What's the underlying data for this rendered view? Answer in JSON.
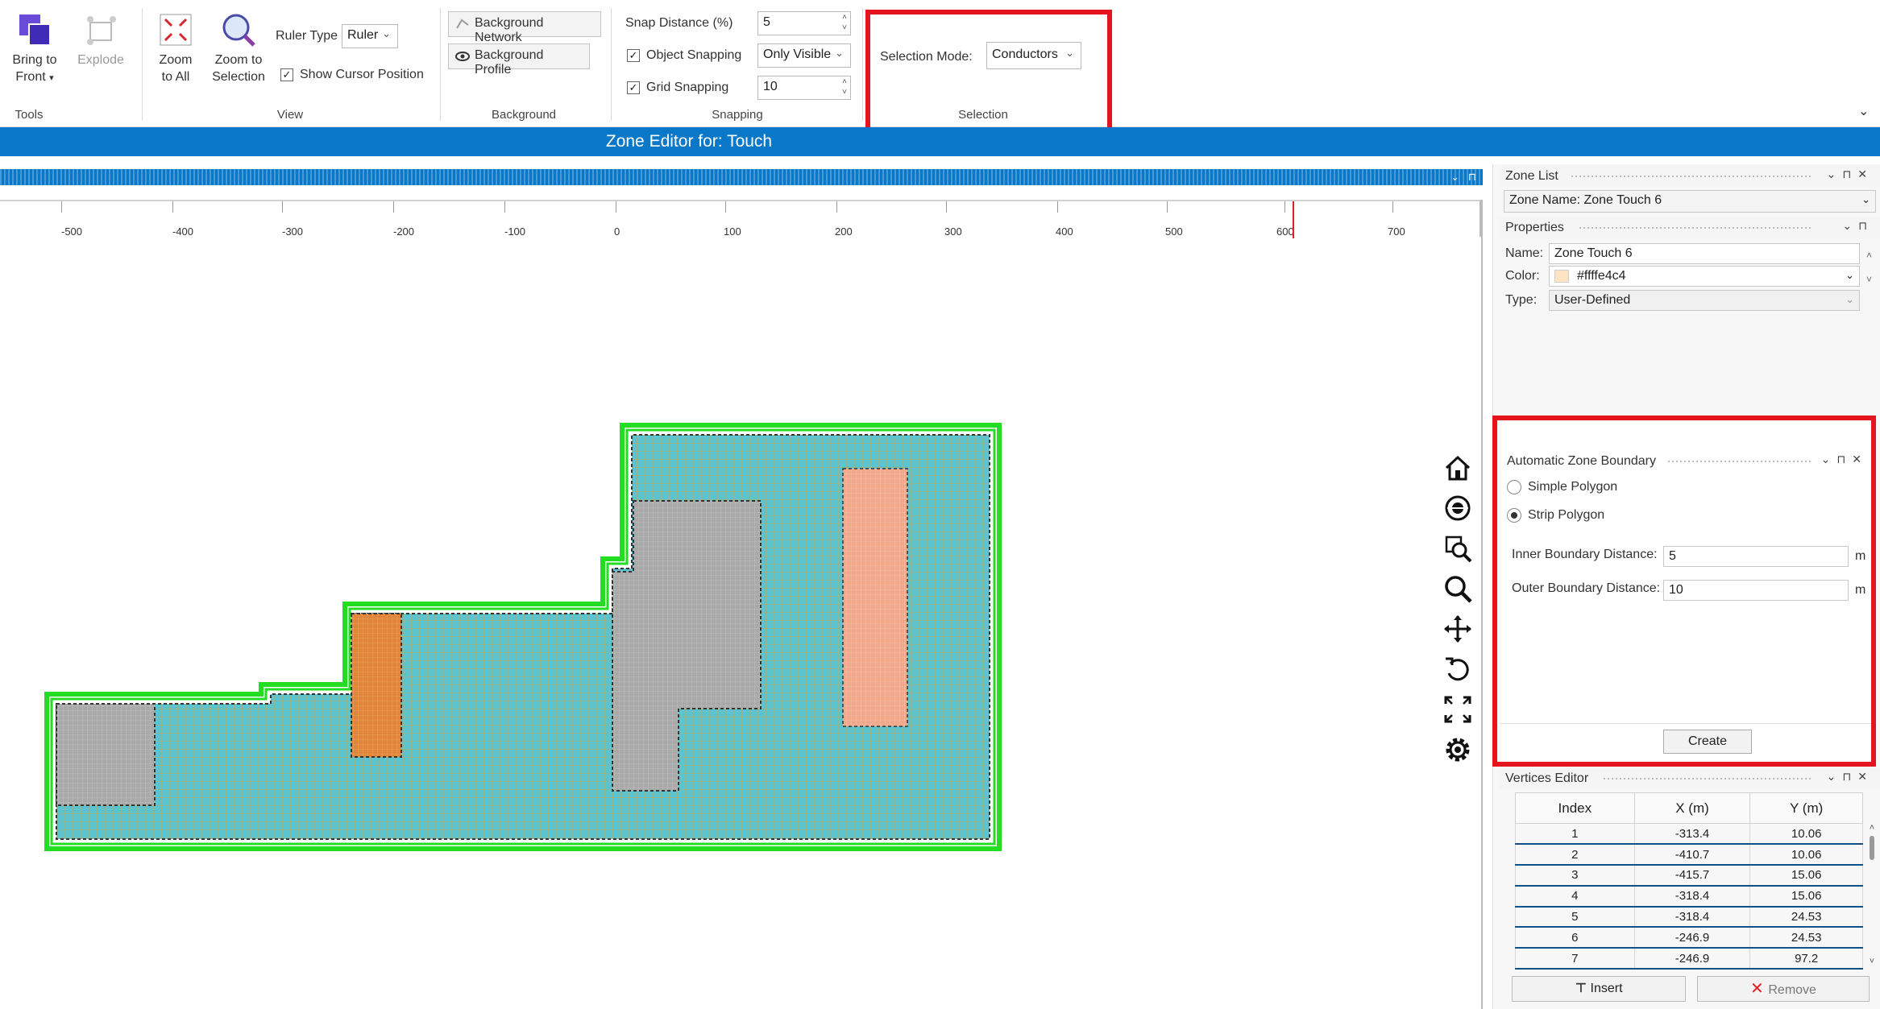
{
  "ribbon": {
    "tools": {
      "bring_to_front": "Bring to",
      "bring_to_front_2": "Front",
      "explode": "Explode",
      "group": "Tools"
    },
    "view": {
      "zoom_all_1": "Zoom",
      "zoom_all_2": "to All",
      "zoom_sel_1": "Zoom to",
      "zoom_sel_2": "Selection",
      "ruler_type_label": "Ruler Type",
      "ruler_type_value": "Ruler",
      "show_cursor": "Show Cursor Position",
      "group": "View"
    },
    "background": {
      "network": "Background Network",
      "profile": "Background Profile",
      "group": "Background"
    },
    "snapping": {
      "snap_distance_label": "Snap Distance (%)",
      "snap_distance_value": "5",
      "object_snapping": "Object Snapping",
      "object_snapping_value": "Only Visible",
      "grid_snapping": "Grid Snapping",
      "grid_snapping_value": "10",
      "group": "Snapping"
    },
    "selection": {
      "mode_label": "Selection Mode:",
      "mode_value": "Conductors",
      "group": "Selection"
    }
  },
  "title": "Zone Editor for: Touch",
  "ruler": {
    "labels": [
      "-500",
      "-400",
      "-300",
      "-200",
      "-100",
      "0",
      "100",
      "200",
      "300",
      "400",
      "500",
      "600",
      "700"
    ]
  },
  "zone_list": {
    "header": "Zone List",
    "selected": "Zone Name: Zone Touch 6"
  },
  "properties": {
    "header": "Properties",
    "name_label": "Name:",
    "name_value": "Zone Touch 6",
    "color_label": "Color:",
    "color_value": "#ffffe4c4",
    "color_swatch": "#ffe4c4",
    "type_label": "Type:",
    "type_value": "User-Defined"
  },
  "auto_boundary": {
    "header": "Automatic Zone Boundary",
    "simple": "Simple Polygon",
    "strip": "Strip Polygon",
    "inner_label": "Inner Boundary Distance:",
    "inner_value": "5",
    "inner_unit": "m",
    "outer_label": "Outer Boundary Distance:",
    "outer_value": "10",
    "outer_unit": "m",
    "create": "Create"
  },
  "vertices": {
    "header": "Vertices Editor",
    "columns": [
      "Index",
      "X (m)",
      "Y (m)"
    ],
    "rows": [
      [
        "1",
        "-313.4",
        "10.06"
      ],
      [
        "2",
        "-410.7",
        "10.06"
      ],
      [
        "3",
        "-415.7",
        "15.06"
      ],
      [
        "4",
        "-318.4",
        "15.06"
      ],
      [
        "5",
        "-318.4",
        "24.53"
      ],
      [
        "6",
        "-246.9",
        "24.53"
      ],
      [
        "7",
        "-246.9",
        "97.2"
      ]
    ],
    "insert": "Insert",
    "remove": "Remove"
  },
  "colors": {
    "accent": "#0a78c8",
    "highlight": "#e6141e",
    "boundary": "#22dd22",
    "zone_fill": "#5bc4cf"
  }
}
